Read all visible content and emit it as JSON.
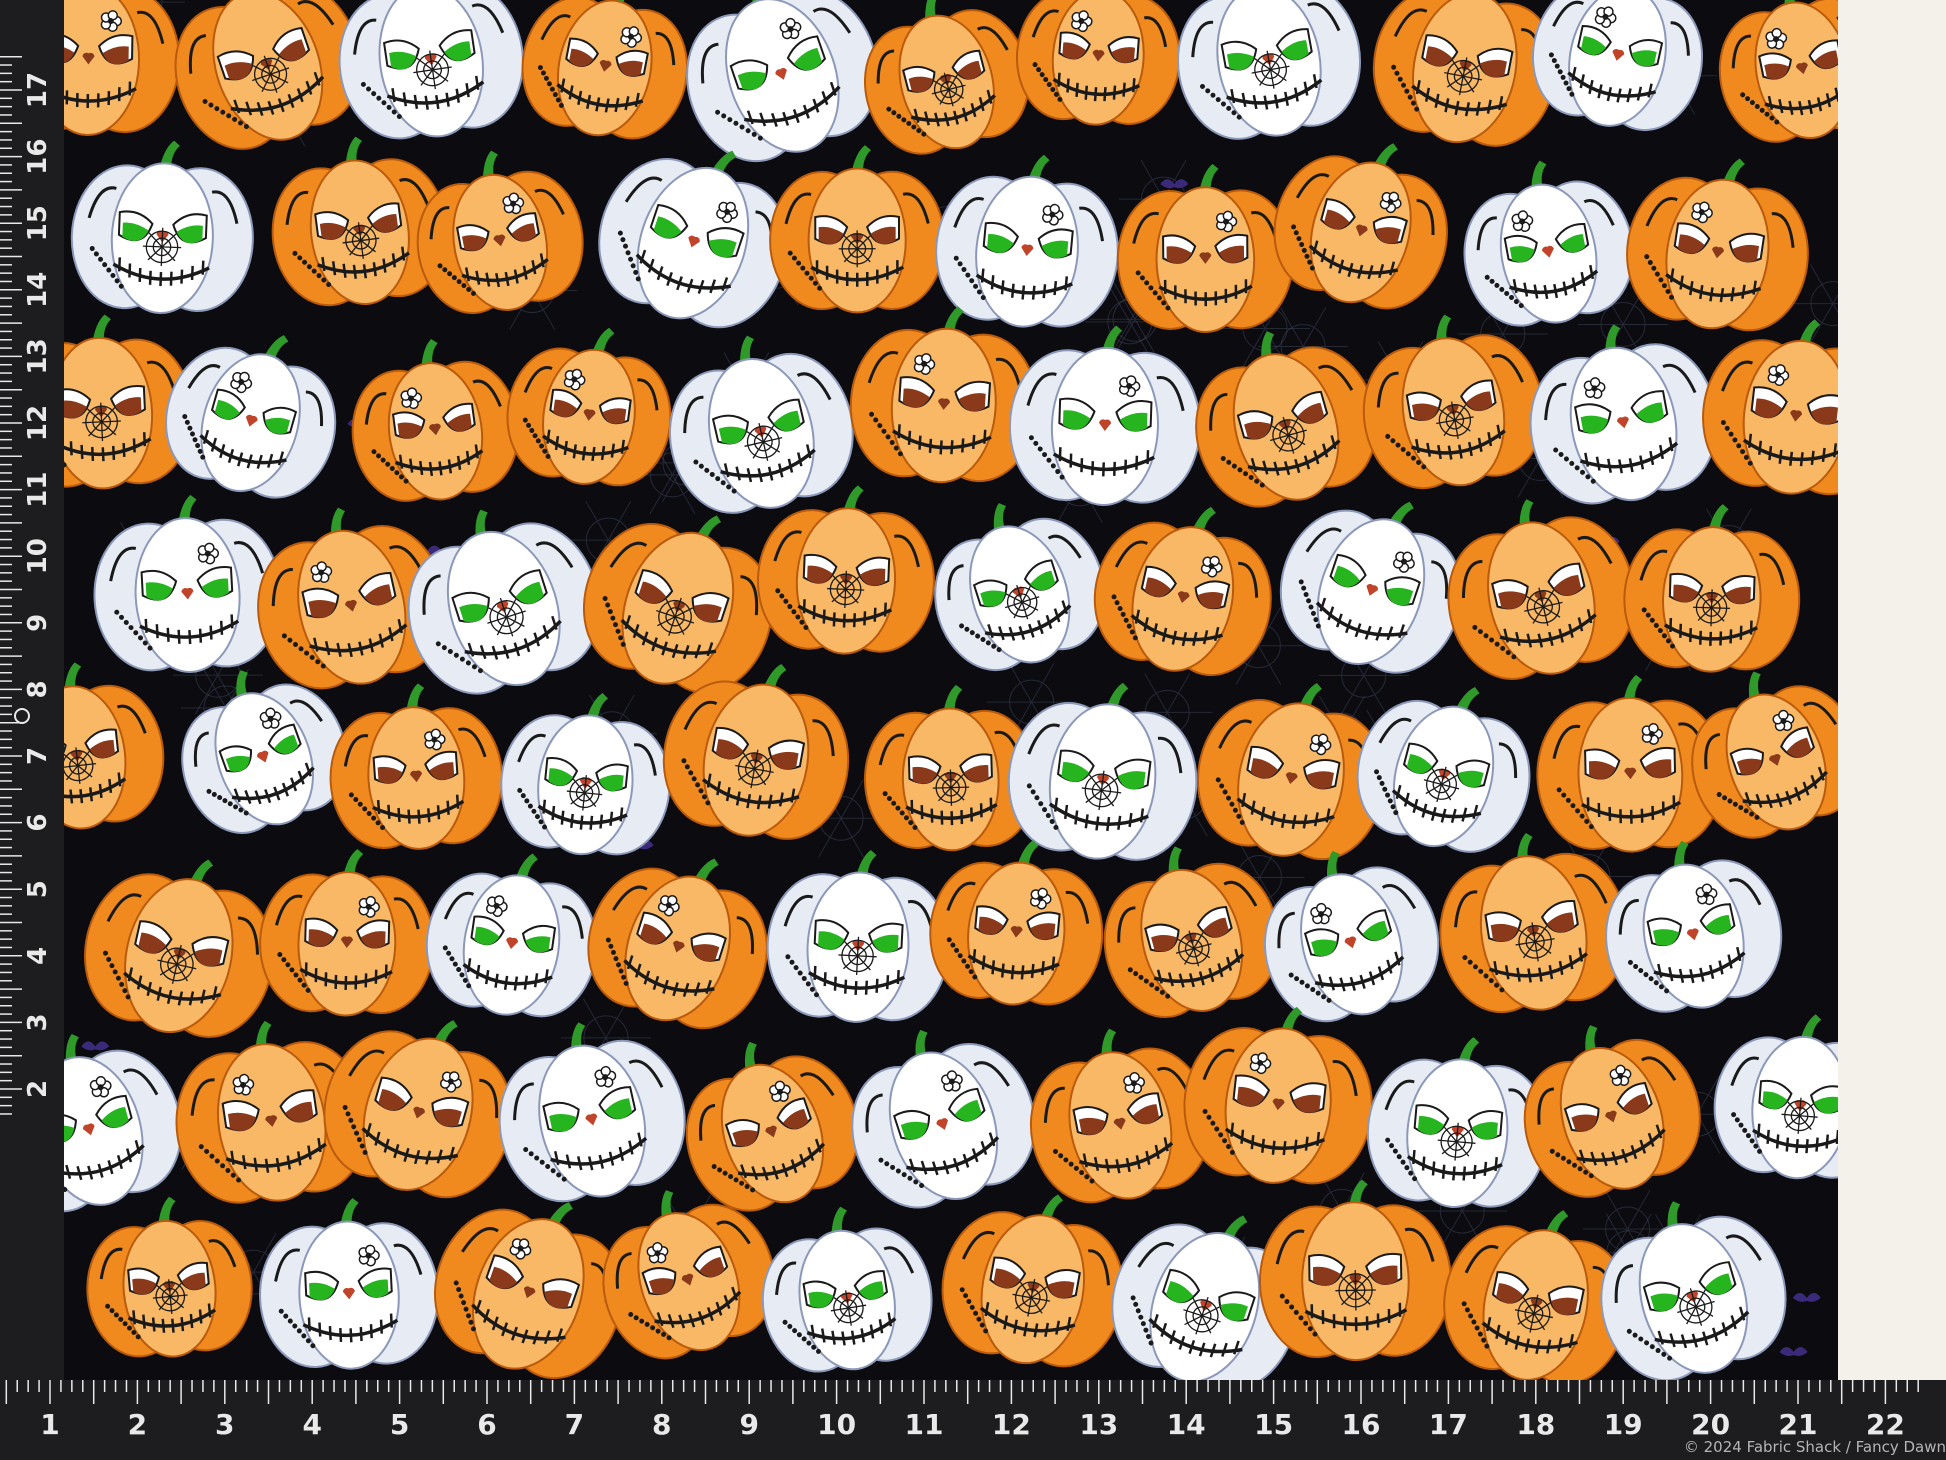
{
  "ruler": {
    "horizontal_labels": [
      "1",
      "2",
      "3",
      "4",
      "5",
      "6",
      "7",
      "8",
      "9",
      "10",
      "11",
      "12",
      "13",
      "14",
      "15",
      "16",
      "17",
      "18",
      "19",
      "20",
      "21",
      "22"
    ],
    "vertical_labels": [
      "17",
      "16",
      "15",
      "14",
      "13",
      "12",
      "11",
      "10",
      "9",
      "8",
      "7",
      "6",
      "5",
      "4",
      "3",
      "2"
    ]
  },
  "watermark": "© 2024 Fabric Shack / Fancy Dawn",
  "colors": {
    "background": "#0b0b10",
    "ruler": "#1d1d20",
    "ruler_text": "#e9e9e9",
    "orange_pumpkin": "#f08a1e",
    "white_pumpkin": "#e6ebf4",
    "eye_green": "#27b51f",
    "eye_brown": "#8a3a1a",
    "selvage": "#f3f1ea"
  }
}
